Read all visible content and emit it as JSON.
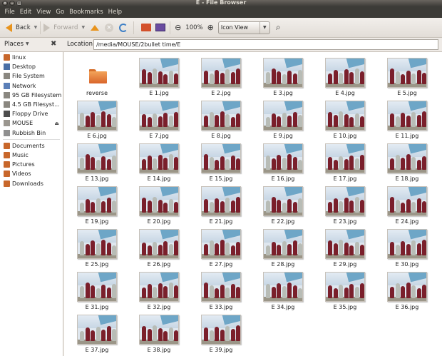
{
  "window": {
    "title": "E - File Browser"
  },
  "menu": [
    "File",
    "Edit",
    "View",
    "Go",
    "Bookmarks",
    "Help"
  ],
  "toolbar": {
    "back_label": "Back",
    "forward_label": "Forward",
    "zoom_level": "100%",
    "view_mode": "Icon View"
  },
  "location": {
    "label": "Location:",
    "path": "/media/MOUSE/2bullet time/E"
  },
  "sidebar": {
    "header": "Places",
    "groups": [
      [
        {
          "label": "linux",
          "icon": "home-folder-icon"
        },
        {
          "label": "Desktop",
          "icon": "desktop-icon"
        },
        {
          "label": "File System",
          "icon": "harddisk-icon"
        },
        {
          "label": "Network",
          "icon": "network-icon"
        },
        {
          "label": "95 GB Filesystem",
          "icon": "harddisk-icon"
        },
        {
          "label": "4.5 GB Filesyst...",
          "icon": "harddisk-icon"
        },
        {
          "label": "Floppy Drive",
          "icon": "floppy-icon"
        },
        {
          "label": "MOUSE",
          "icon": "usb-drive-icon",
          "eject": true
        },
        {
          "label": "Rubbish Bin",
          "icon": "trash-icon"
        }
      ],
      [
        {
          "label": "Documents",
          "icon": "documents-folder-icon"
        },
        {
          "label": "Music",
          "icon": "music-folder-icon"
        },
        {
          "label": "Pictures",
          "icon": "pictures-folder-icon"
        },
        {
          "label": "Videos",
          "icon": "videos-folder-icon"
        },
        {
          "label": "Downloads",
          "icon": "downloads-folder-icon"
        }
      ]
    ]
  },
  "files": [
    {
      "name": "reverse",
      "type": "folder"
    },
    {
      "name": "E 1.jpg",
      "type": "image"
    },
    {
      "name": "E 2.jpg",
      "type": "image"
    },
    {
      "name": "E 3.jpg",
      "type": "image"
    },
    {
      "name": "E 4.jpg",
      "type": "image"
    },
    {
      "name": "E 5.jpg",
      "type": "image"
    },
    {
      "name": "E 6.jpg",
      "type": "image"
    },
    {
      "name": "E 7.jpg",
      "type": "image"
    },
    {
      "name": "E 8.jpg",
      "type": "image"
    },
    {
      "name": "E 9.jpg",
      "type": "image"
    },
    {
      "name": "E 10.jpg",
      "type": "image"
    },
    {
      "name": "E 11.jpg",
      "type": "image"
    },
    {
      "name": "E 13.jpg",
      "type": "image"
    },
    {
      "name": "E 14.jpg",
      "type": "image"
    },
    {
      "name": "E 15.jpg",
      "type": "image"
    },
    {
      "name": "E 16.jpg",
      "type": "image"
    },
    {
      "name": "E 17.jpg",
      "type": "image"
    },
    {
      "name": "E 18.jpg",
      "type": "image"
    },
    {
      "name": "E 19.jpg",
      "type": "image"
    },
    {
      "name": "E 20.jpg",
      "type": "image"
    },
    {
      "name": "E 21.jpg",
      "type": "image"
    },
    {
      "name": "E 22.jpg",
      "type": "image"
    },
    {
      "name": "E 23.jpg",
      "type": "image"
    },
    {
      "name": "E 24.jpg",
      "type": "image"
    },
    {
      "name": "E 25.jpg",
      "type": "image"
    },
    {
      "name": "E 26.jpg",
      "type": "image"
    },
    {
      "name": "E 27.jpg",
      "type": "image"
    },
    {
      "name": "E 28.jpg",
      "type": "image"
    },
    {
      "name": "E 29.jpg",
      "type": "image"
    },
    {
      "name": "E 30.jpg",
      "type": "image"
    },
    {
      "name": "E 31.jpg",
      "type": "image"
    },
    {
      "name": "E 32.jpg",
      "type": "image"
    },
    {
      "name": "E 33.jpg",
      "type": "image"
    },
    {
      "name": "E 34.jpg",
      "type": "image"
    },
    {
      "name": "E 35.jpg",
      "type": "image"
    },
    {
      "name": "E 36.jpg",
      "type": "image"
    },
    {
      "name": "E 37.jpg",
      "type": "image"
    },
    {
      "name": "E 38.jpg",
      "type": "image"
    },
    {
      "name": "E 39.jpg",
      "type": "image"
    }
  ],
  "colors": {
    "titlebar": "#3c3b37",
    "accent_orange": "#e8931c",
    "uniform_maroon": "#7a1f2b",
    "uniform_grey": "#b8bcb6",
    "shade_sail_blue": "#6ea6c7"
  }
}
